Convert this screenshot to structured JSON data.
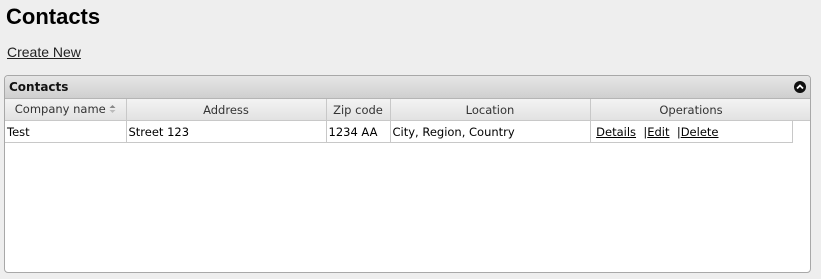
{
  "page": {
    "title": "Contacts",
    "create_link": "Create New"
  },
  "panel": {
    "title": "Contacts"
  },
  "table": {
    "columns": [
      "Company name",
      "Address",
      "Zip code",
      "Location",
      "Operations"
    ],
    "rows": [
      {
        "company": "Test",
        "address": "Street 123",
        "zip": "1234 AA",
        "location": "City, Region, Country",
        "operations": {
          "details": "Details",
          "separator": "|",
          "edit": "Edit",
          "delete": "Delete"
        }
      }
    ]
  },
  "icons": {
    "collapse": "chevron-up-icon",
    "sort": "sort-icon"
  }
}
